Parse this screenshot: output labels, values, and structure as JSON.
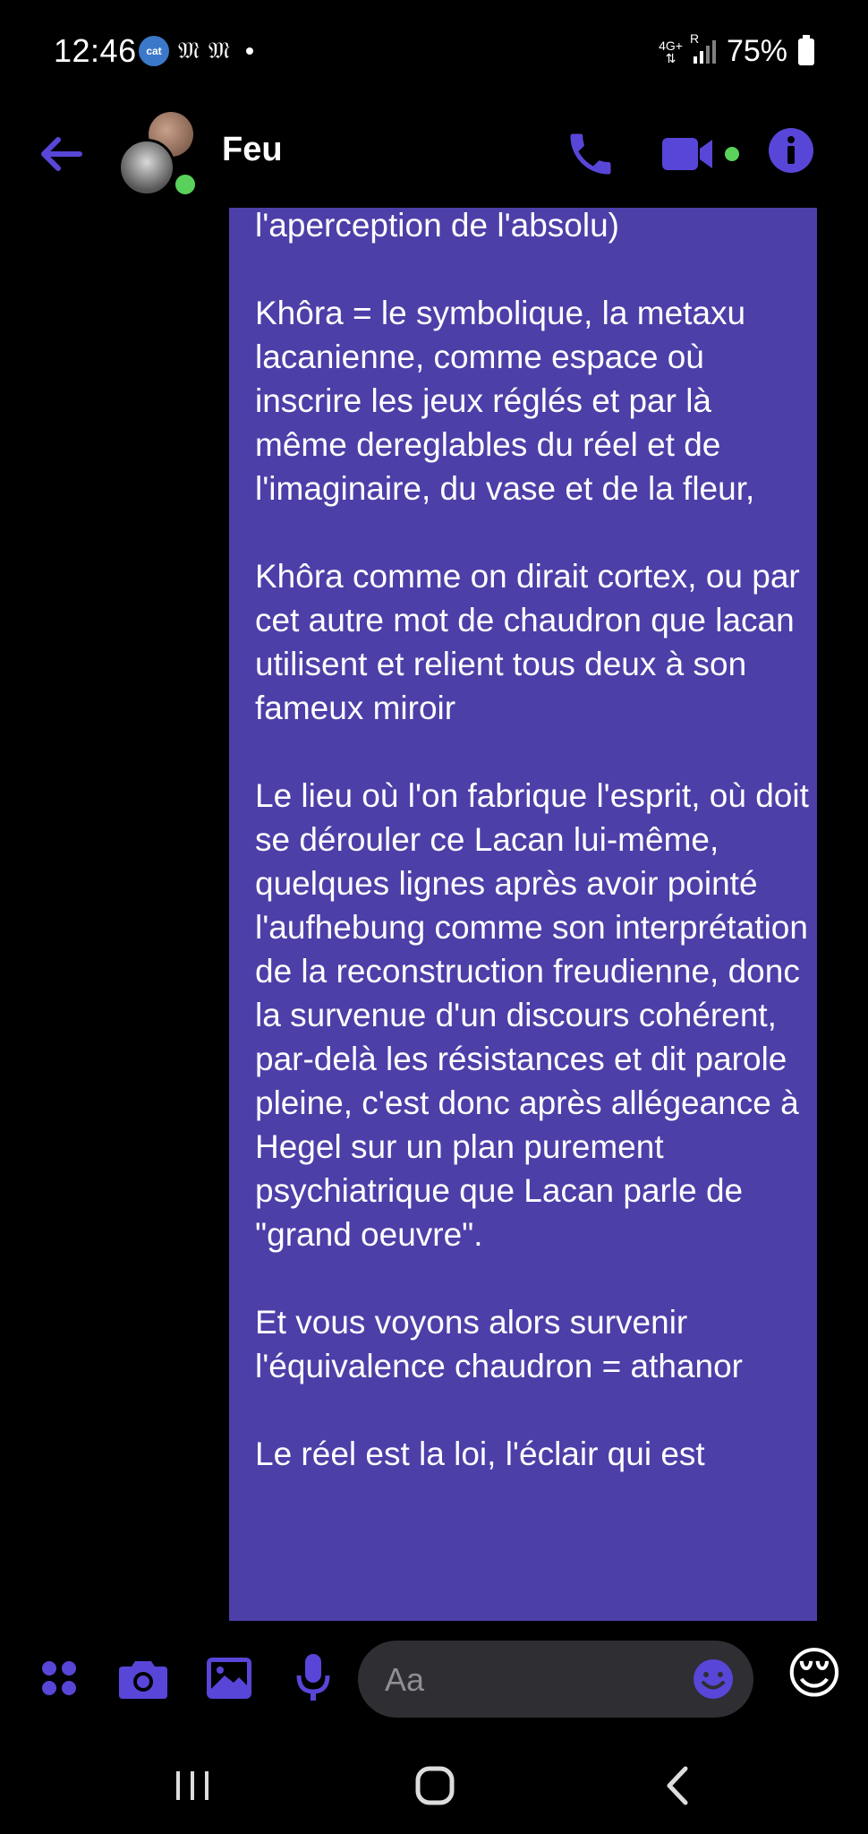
{
  "status_bar": {
    "time": "12:46",
    "left_icons": [
      "cat-badge-icon",
      "newspaper-m-icon",
      "newspaper-m-icon",
      "dot-icon"
    ],
    "cat_badge_label": "cat",
    "m_glyph": "𝔐",
    "network_label": "4G+",
    "roaming_label": "R",
    "battery_percent": "75%"
  },
  "header": {
    "contact_name": "Feu",
    "accent_color": "#5846d8",
    "online_color": "#5ad15a"
  },
  "message": {
    "bubble_color": "#4c3fa8",
    "text": "l'aperception de l'absolu)\n\nKhôra = le symbolique, la metaxu lacanienne, comme espace où inscrire les jeux réglés et par là même dereglables du réel et de l'imaginaire, du vase et de la fleur,\n\nKhôra comme on dirait cortex, ou par cet autre mot de chaudron que lacan utilisent et relient tous deux à son fameux miroir\n\nLe lieu où l'on fabrique l'esprit, où doit se dérouler ce Lacan lui-même, quelques lignes après avoir pointé l'aufhebung comme son interprétation de la reconstruction freudienne, donc la survenue d'un discours cohérent, par-delà les résistances et dit parole pleine, c'est donc après allégeance à Hegel sur un plan purement psychiatrique que Lacan parle de \"grand oeuvre\".\n\nEt vous voyons alors survenir l'équivalence chaudron = athanor\n\nLe réel est la loi, l'éclair qui est"
  },
  "composer": {
    "placeholder": "Aa",
    "tools": [
      "menu-grid-icon",
      "camera-icon",
      "image-icon",
      "microphone-icon"
    ],
    "quick_reaction": "😌"
  },
  "nav_bar": {
    "buttons": [
      "recent-apps-icon",
      "home-icon",
      "back-icon"
    ]
  }
}
